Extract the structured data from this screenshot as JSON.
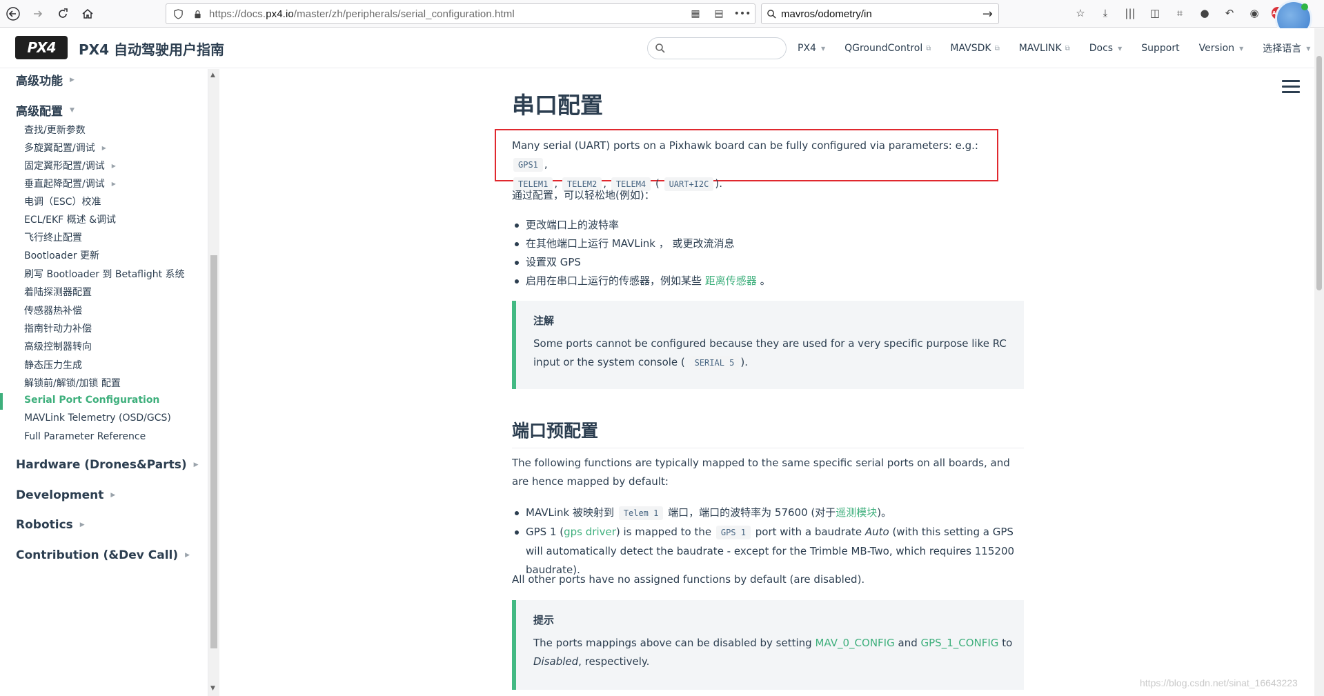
{
  "browser": {
    "url_prefix": "https://docs.",
    "url_domain": "px4.io",
    "url_path": "/master/zh/peripherals/serial_configuration.html",
    "search_value": "mavros/odometry/in"
  },
  "header": {
    "logo_text": "PX4",
    "title": "PX4 自动驾驶用户指南",
    "search_placeholder": "",
    "nav": [
      {
        "label": "PX4",
        "kind": "dropdown"
      },
      {
        "label": "QGroundControl",
        "kind": "external"
      },
      {
        "label": "MAVSDK",
        "kind": "external"
      },
      {
        "label": "MAVLINK",
        "kind": "external"
      },
      {
        "label": "Docs",
        "kind": "dropdown"
      },
      {
        "label": "Support",
        "kind": "plain"
      },
      {
        "label": "Version",
        "kind": "dropdown"
      },
      {
        "label": "选择语言",
        "kind": "dropdown"
      }
    ]
  },
  "sidebar": {
    "sections": [
      {
        "label": "高级功能"
      },
      {
        "label": "高级配置"
      }
    ],
    "items": [
      {
        "label": "查找/更新参数"
      },
      {
        "label": "多旋翼配置/调试"
      },
      {
        "label": "固定翼形配置/调试"
      },
      {
        "label": "垂直起降配置/调试"
      },
      {
        "label": "电调（ESC）校准"
      },
      {
        "label": "ECL/EKF 概述 &调试"
      },
      {
        "label": "飞行终止配置"
      },
      {
        "label": "Bootloader 更新"
      },
      {
        "label": "刷写 Bootloader 到 Betaflight 系统"
      },
      {
        "label": "着陆探测器配置"
      },
      {
        "label": "传感器热补偿"
      },
      {
        "label": "指南针动力补偿"
      },
      {
        "label": "高级控制器转向"
      },
      {
        "label": "静态压力生成"
      },
      {
        "label": "解锁前/解锁/加锁 配置"
      },
      {
        "label": "Serial Port Configuration"
      },
      {
        "label": "MAVLink Telemetry (OSD/GCS)"
      },
      {
        "label": "Full Parameter Reference"
      }
    ],
    "bottom_sections": [
      {
        "label": "Hardware (Drones&Parts)"
      },
      {
        "label": "Development"
      },
      {
        "label": "Robotics"
      },
      {
        "label": "Contribution (&Dev Call)"
      }
    ]
  },
  "content": {
    "title": "串口配置",
    "intro_text": "Many serial (UART) ports on a Pixhawk board can be fully configured via parameters: e.g.:",
    "intro_codes": [
      "GPS1",
      "TELEM1",
      "TELEM2",
      "TELEM4",
      "UART+I2C"
    ],
    "config_intro": "通过配置，可以轻松地(例如)：",
    "list1": [
      "更改端口上的波特率",
      "在其他端口上运行 MAVLink ，  或更改流消息",
      "设置双 GPS",
      "启用在串口上运行的传感器，例如某些"
    ],
    "list1_link": "距离传感器",
    "note1_title": "注解",
    "note1_text": "Some ports cannot be configured because they are used for a very specific purpose like RC input or the system console (",
    "note1_code": "SERIAL 5",
    "section_title": "端口预配置",
    "para3": "The following functions are typically mapped to the same specific serial ports on all boards, and are hence mapped by default:",
    "list2_item1_a": "MAVLink 被映射到",
    "list2_item1_code": "Telem 1",
    "list2_item1_b": "端口，端口的波特率为 57600 (对于",
    "list2_item1_link": "遥测模块",
    "list2_item1_c": ")。",
    "list2_item2_a": "GPS 1 (",
    "list2_item2_link": "gps driver",
    "list2_item2_b": ") is mapped to the",
    "list2_item2_code": "GPS 1",
    "list2_item2_c": "port with a baudrate",
    "list2_item2_em": "Auto",
    "list2_item2_d": "(with this setting a GPS will automatically detect the baudrate - except for the Trimble MB-Two, which requires 115200 baudrate).",
    "para4": "All other ports have no assigned functions by default (are disabled).",
    "note2_title": "提示",
    "note2_a": "The ports mappings above can be disabled by setting",
    "note2_link1": "MAV_0_CONFIG",
    "note2_and": "and",
    "note2_link2": "GPS_1_CONFIG",
    "note2_to": "to",
    "note2_em": "Disabled",
    "note2_end": ", respectively."
  },
  "watermark": "https://blog.csdn.net/sinat_16643223",
  "colors": {
    "accent": "#3eaf7c",
    "highlight_box": "#e0282e",
    "text": "#2c3e50"
  }
}
